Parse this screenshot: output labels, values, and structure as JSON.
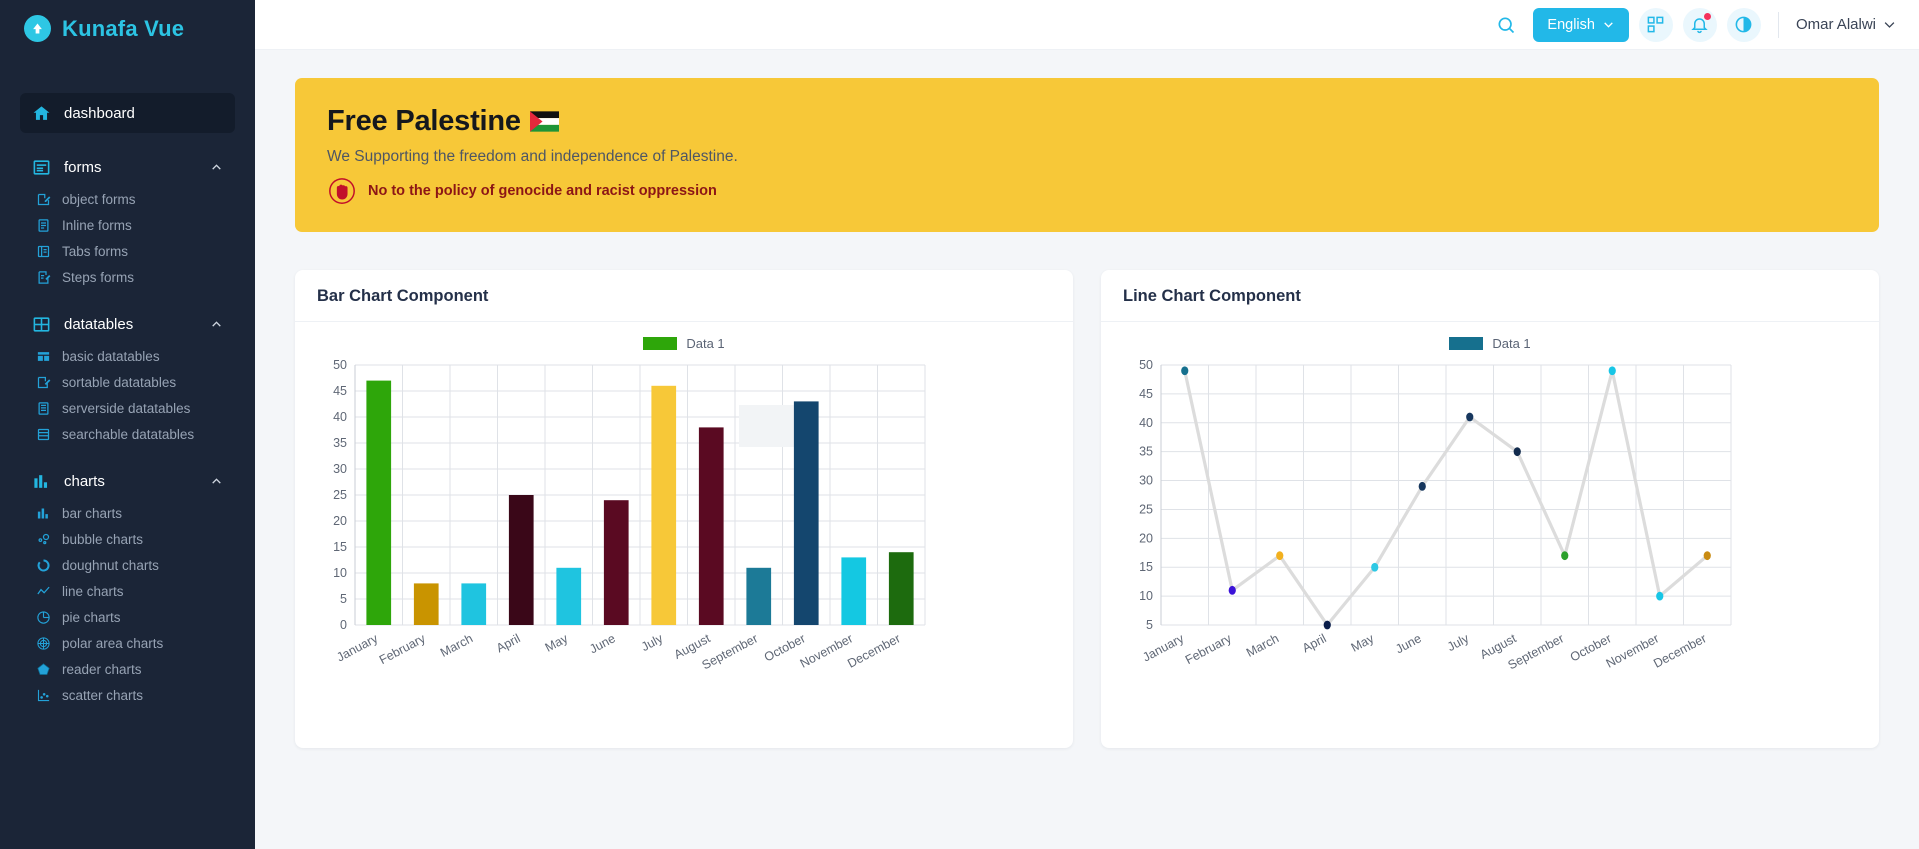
{
  "brand": {
    "title": "Kunafa Vue",
    "logo_icon": "up-arrow-circle-icon"
  },
  "sidebar": {
    "dashboard": {
      "label": "dashboard",
      "icon": "home-icon"
    },
    "groups": [
      {
        "label": "forms",
        "icon": "forms-icon",
        "chevron": "chevron-up-icon",
        "items": [
          {
            "label": "object forms",
            "icon": "edit-doc-icon"
          },
          {
            "label": "Inline forms",
            "icon": "inline-doc-icon"
          },
          {
            "label": "Tabs forms",
            "icon": "tabs-doc-icon"
          },
          {
            "label": "Steps forms",
            "icon": "steps-doc-icon"
          }
        ]
      },
      {
        "label": "datatables",
        "icon": "table-icon",
        "chevron": "chevron-up-icon",
        "items": [
          {
            "label": "basic datatables",
            "icon": "grid-icon"
          },
          {
            "label": "sortable datatables",
            "icon": "sort-icon"
          },
          {
            "label": "serverside datatables",
            "icon": "server-icon"
          },
          {
            "label": "searchable datatables",
            "icon": "list-icon"
          }
        ]
      },
      {
        "label": "charts",
        "icon": "bar-chart-icon",
        "chevron": "chevron-up-icon",
        "items": [
          {
            "label": "bar charts",
            "icon": "bar-chart-icon"
          },
          {
            "label": "bubble charts",
            "icon": "bubble-icon"
          },
          {
            "label": "doughnut charts",
            "icon": "doughnut-icon"
          },
          {
            "label": "line charts",
            "icon": "line-chart-icon"
          },
          {
            "label": "pie charts",
            "icon": "pie-icon"
          },
          {
            "label": "polar area charts",
            "icon": "polar-icon"
          },
          {
            "label": "reader charts",
            "icon": "radar-icon"
          },
          {
            "label": "scatter charts",
            "icon": "scatter-icon"
          }
        ]
      }
    ]
  },
  "topbar": {
    "search_icon": "search-icon",
    "language": {
      "label": "English",
      "chevron": "chevron-down-icon"
    },
    "apps_icon": "apps-grid-icon",
    "notifications_icon": "bell-icon",
    "theme_icon": "contrast-circle-icon",
    "user": {
      "name": "Omar Alalwi",
      "chevron": "chevron-down-icon"
    }
  },
  "banner": {
    "title": "Free Palestine",
    "flag_icon": "palestine-flag-icon",
    "subtitle": "We Supporting the freedom and independence of Palestine.",
    "note_icon": "stop-hand-icon",
    "note": "No to the policy of genocide and racist oppression",
    "bg_color": "#f7c838"
  },
  "cards": {
    "bar": {
      "title": "Bar Chart Component"
    },
    "line": {
      "title": "Line Chart Component"
    }
  },
  "chart_data": [
    {
      "type": "bar",
      "title": "Bar Chart Component",
      "legend": [
        "Data 1"
      ],
      "legend_position": "top",
      "legend_swatch_color": "#2ea60a",
      "categories": [
        "January",
        "February",
        "March",
        "April",
        "May",
        "June",
        "July",
        "August",
        "September",
        "October",
        "November",
        "December"
      ],
      "values": [
        47,
        8,
        8,
        25,
        11,
        24,
        46,
        38,
        11,
        43,
        13,
        14
      ],
      "colors": [
        "#2ea60a",
        "#c99400",
        "#1fc4e0",
        "#3a0718",
        "#1fc4e0",
        "#5a0a22",
        "#f7c838",
        "#5a0a22",
        "#1c7a97",
        "#14466e",
        "#14c8e2",
        "#1d6b0e"
      ],
      "yticks": [
        0,
        5,
        10,
        15,
        20,
        25,
        30,
        35,
        40,
        45,
        50
      ],
      "ylim": [
        0,
        50
      ],
      "xlabel": "",
      "ylabel": "",
      "grid": true
    },
    {
      "type": "line",
      "title": "Line Chart Component",
      "legend": [
        "Data 1"
      ],
      "legend_position": "top",
      "legend_swatch_color": "#16708e",
      "categories": [
        "January",
        "February",
        "March",
        "April",
        "May",
        "June",
        "July",
        "August",
        "September",
        "October",
        "November",
        "December"
      ],
      "values": [
        49,
        11,
        17,
        5,
        15,
        29,
        41,
        35,
        17,
        49,
        10,
        17
      ],
      "point_colors": [
        "#16708e",
        "#3b12d8",
        "#f2b01e",
        "#0a1d4a",
        "#2ec8e4",
        "#17375e",
        "#17375e",
        "#122b4d",
        "#2ca02c",
        "#18c6e6",
        "#18c6e6",
        "#c98b12"
      ],
      "line_color": "#dcdcdc",
      "yticks": [
        5,
        10,
        15,
        20,
        25,
        30,
        35,
        40,
        45,
        50
      ],
      "ylim": [
        5,
        50
      ],
      "xlabel": "",
      "ylabel": "",
      "grid": true
    }
  ]
}
